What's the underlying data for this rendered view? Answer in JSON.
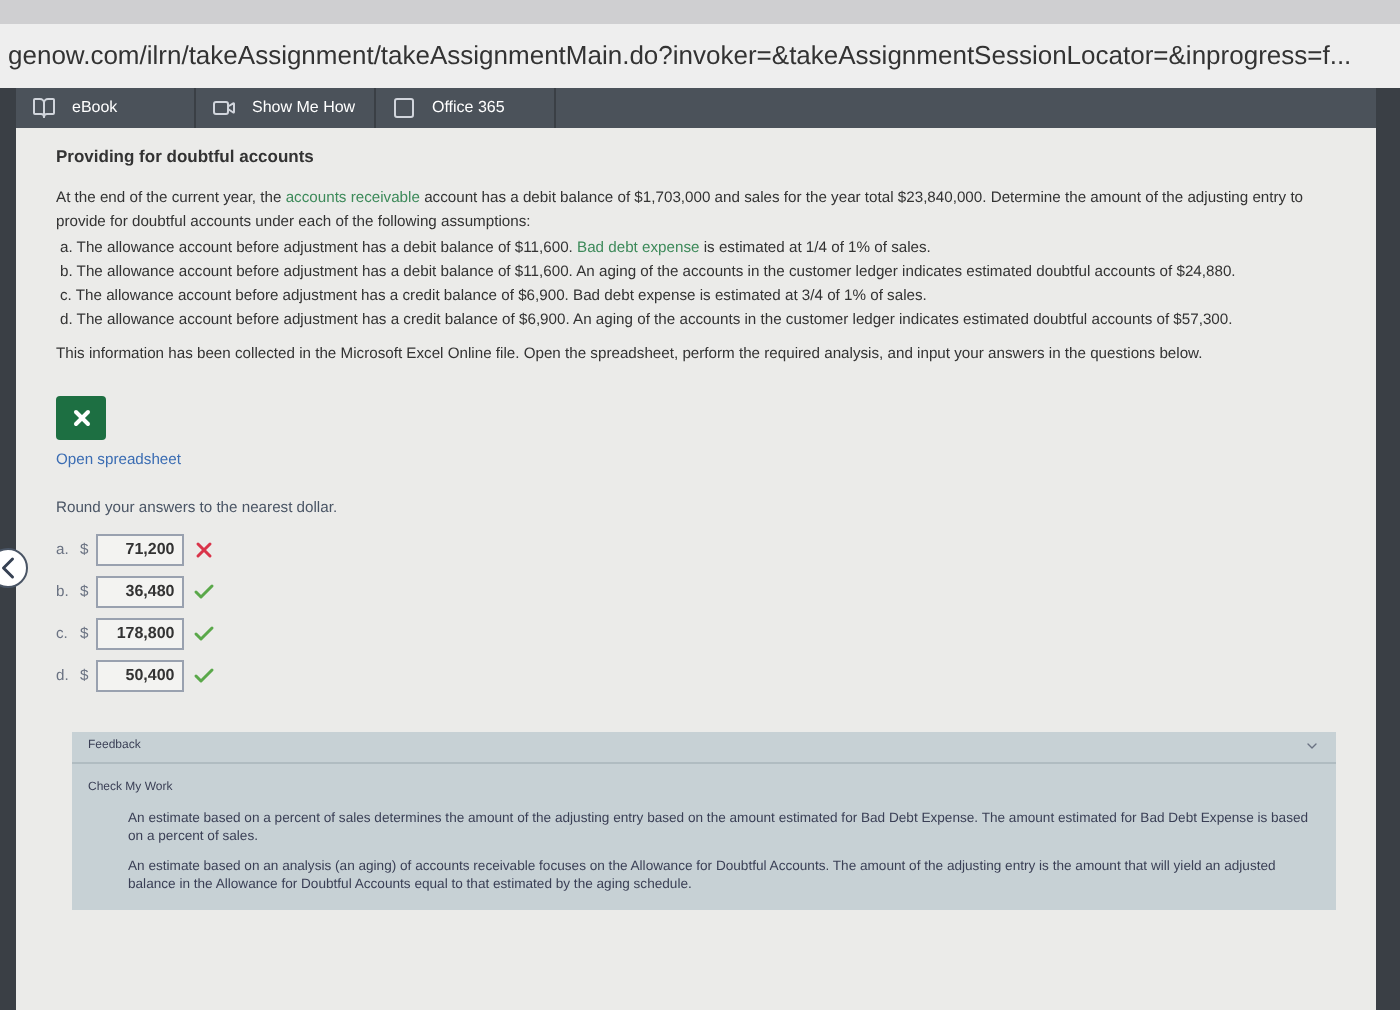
{
  "address_bar": {
    "url": "genow.com/ilrn/takeAssignment/takeAssignmentMain.do?invoker=&takeAssignmentSessionLocator=&inprogress=f..."
  },
  "toolbar": [
    {
      "label": "eBook",
      "kind": "book"
    },
    {
      "label": "Show Me How",
      "kind": "video"
    },
    {
      "label": "Office 365",
      "kind": "office"
    }
  ],
  "problem": {
    "title": "Providing for doubtful accounts",
    "intro": [
      {
        "text": "At the end of the current year, the ",
        "link": false
      },
      {
        "text": "accounts receivable",
        "link": true
      },
      {
        "text": " account has a debit balance of $1,703,000 and sales for the year total $23,840,000. Determine the amount of the adjusting entry to provide for doubtful accounts under each of the following assumptions:",
        "link": false
      }
    ],
    "assumptions": [
      [
        {
          "text": "a. The allowance account before adjustment has a debit balance of $11,600. ",
          "link": false
        },
        {
          "text": "Bad debt expense",
          "link": true
        },
        {
          "text": " is estimated at 1/4 of 1% of sales.",
          "link": false
        }
      ],
      [
        {
          "text": "b. The allowance account before adjustment has a debit balance of $11,600. An aging of the accounts in the customer ledger indicates estimated doubtful accounts of $24,880.",
          "link": false
        }
      ],
      [
        {
          "text": "c. The allowance account before adjustment has a credit balance of $6,900. Bad debt expense is estimated at 3/4 of 1% of sales.",
          "link": false
        }
      ],
      [
        {
          "text": "d. The allowance account before adjustment has a credit balance of $6,900. An aging of the accounts in the customer ledger indicates estimated doubtful accounts of $57,300.",
          "link": false
        }
      ]
    ],
    "info": "This information has been collected in the Microsoft Excel Online file. Open the spreadsheet, perform the required analysis, and input your answers in the questions below.",
    "spreadsheet_link": "Open spreadsheet",
    "instruction": "Round your answers to the nearest dollar.",
    "answers": [
      {
        "label": "a.",
        "currency": "$",
        "value": "71,200",
        "correct": false
      },
      {
        "label": "b.",
        "currency": "$",
        "value": "36,480",
        "correct": true
      },
      {
        "label": "c.",
        "currency": "$",
        "value": "178,800",
        "correct": true
      },
      {
        "label": "d.",
        "currency": "$",
        "value": "50,400",
        "correct": true
      }
    ]
  },
  "feedback": {
    "title": "Feedback",
    "expanded": true,
    "section": "Check My Work",
    "paragraphs": [
      "An estimate based on a percent of sales determines the amount of the adjusting entry based on the amount estimated for Bad Debt Expense. The amount estimated for Bad Debt Expense is based on a percent of sales.",
      "An estimate based on an analysis (an aging) of accounts receivable focuses on the Allowance for Doubtful Accounts. The amount of the adjusting entry is the amount that will yield an adjusted balance in the Allowance for Doubtful Accounts equal to that estimated by the aging schedule."
    ]
  }
}
